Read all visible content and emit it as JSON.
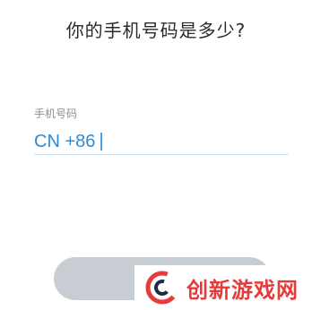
{
  "title": "你的手机号码是多少?",
  "phone_field": {
    "label": "手机号码",
    "prefix": "CN +86",
    "value": ""
  },
  "submit_button": {
    "label": ""
  },
  "watermark": {
    "text": "创新游戏网"
  },
  "colors": {
    "accent": "#2e8bd4",
    "button_disabled": "#c8cdd3",
    "watermark_red": "#e63b3b"
  }
}
